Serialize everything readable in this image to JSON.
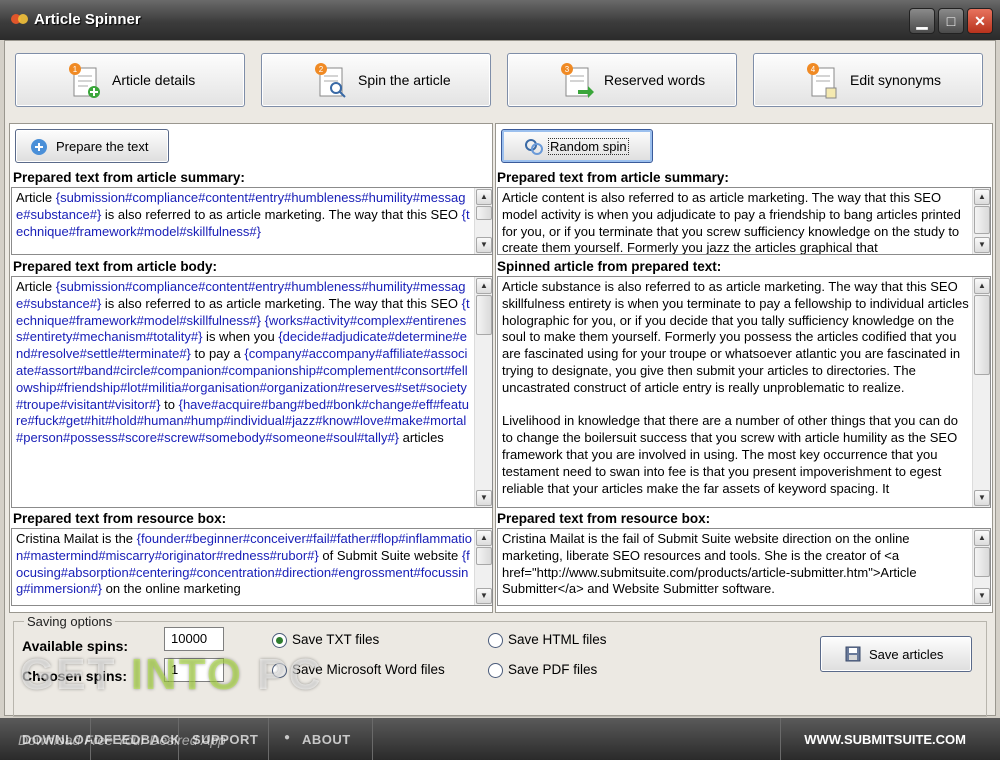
{
  "window": {
    "title": "Article Spinner",
    "controls": {
      "minimize": "▁",
      "maximize": "□",
      "close": "✕"
    }
  },
  "tabs": [
    {
      "label": "Article details",
      "step": "1"
    },
    {
      "label": "Spin the article",
      "step": "2"
    },
    {
      "label": "Reserved words",
      "step": "3"
    },
    {
      "label": "Edit synonyms",
      "step": "4"
    }
  ],
  "left": {
    "prepare_button": "Prepare the text",
    "summary": {
      "label": "Prepared text from article summary:",
      "segments": [
        {
          "t": "Article ",
          "h": false
        },
        {
          "t": "{submission#compliance#content#entry#humbleness#humility#message#substance#}",
          "h": true
        },
        {
          "t": " is also referred to as article marketing. The way that this SEO ",
          "h": false
        },
        {
          "t": "{technique#framework#model#skillfulness#}",
          "h": true
        }
      ]
    },
    "body": {
      "label": "Prepared text from article body:",
      "segments": [
        {
          "t": "Article ",
          "h": false
        },
        {
          "t": "{submission#compliance#content#entry#humbleness#humility#message#substance#}",
          "h": true
        },
        {
          "t": " is also referred to as article marketing. The way that this SEO ",
          "h": false
        },
        {
          "t": "{technique#framework#model#skillfulness#}",
          "h": true
        },
        {
          "t": " ",
          "h": false
        },
        {
          "t": "{works#activity#complex#entireness#entirety#mechanism#totality#}",
          "h": true
        },
        {
          "t": " is when you ",
          "h": false
        },
        {
          "t": "{decide#adjudicate#determine#end#resolve#settle#terminate#}",
          "h": true
        },
        {
          "t": " to pay a ",
          "h": false
        },
        {
          "t": "{company#accompany#affiliate#associate#assort#band#circle#companion#companionship#complement#consort#fellowship#friendship#lot#militia#organisation#organization#reserves#set#society#troupe#visitant#visitor#}",
          "h": true
        },
        {
          "t": " to ",
          "h": false
        },
        {
          "t": "{have#acquire#bang#bed#bonk#change#eff#feature#fuck#get#hit#hold#human#hump#individual#jazz#know#love#make#mortal#person#possess#score#screw#somebody#someone#soul#tally#}",
          "h": true
        },
        {
          "t": " articles",
          "h": false
        }
      ]
    },
    "resource": {
      "label": "Prepared text from resource box:",
      "segments": [
        {
          "t": "Cristina Mailat is the ",
          "h": false
        },
        {
          "t": "{founder#beginner#conceiver#fail#father#flop#inflammation#mastermind#miscarry#originator#redness#rubor#}",
          "h": true
        },
        {
          "t": " of Submit Suite website ",
          "h": false
        },
        {
          "t": "{focusing#absorption#centering#concentration#direction#engrossment#focussing#immersion#}",
          "h": true
        },
        {
          "t": " on the online marketing",
          "h": false
        }
      ]
    }
  },
  "right": {
    "random_button": "Random spin",
    "summary": {
      "label": "Prepared text from article summary:",
      "text": "Article content is also referred to as article marketing. The way that this SEO model activity is when you adjudicate to pay a friendship to bang articles printed for you, or if you terminate that you screw sufficiency knowledge on the study to create them yourself. Formerly you jazz the articles graphical that"
    },
    "spinned": {
      "label": "Spinned article from prepared text:",
      "text": "Article substance is also referred to as article marketing. The way that this SEO skillfulness entirety is when you terminate to pay a fellowship to individual articles holographic for you, or if you decide that you tally sufficiency knowledge on the soul to make them yourself. Formerly you possess the articles codified that you are fascinated using for your troupe or whatsoever atlantic you are fascinated in trying to designate, you give then submit your articles to directories. The uncastrated construct of article entry is really unproblematic to realize.\n\nLivelihood in knowledge that there are a number of other things that you can do to change the boilersuit success that you screw with article humility as the SEO framework that you are involved in using. The most key occurrence that you testament need to swan into fee is that you present impoverishment to egest reliable that your articles make the far assets of keyword spacing. It"
    },
    "resource": {
      "label": "Prepared text from resource box:",
      "text": "Cristina Mailat is the fail of Submit Suite website direction on the online marketing, liberate SEO resources and tools. She is the creator of <a href=\"http://www.submitsuite.com/products/article-submitter.htm\">Article Submitter</a> and Website Submitter software."
    }
  },
  "saving": {
    "legend": "Saving options",
    "available_label": "Available spins:",
    "available_value": "10000",
    "chosen_label": "Choosen spins:",
    "chosen_value": "1",
    "options": {
      "txt": "Save TXT files",
      "word": "Save Microsoft Word files",
      "html": "Save HTML files",
      "pdf": "Save PDF files"
    },
    "selected": "txt",
    "save_button": "Save articles"
  },
  "footer": {
    "items": [
      "DOWNLOAD",
      "FEEDBACK",
      "SUPPORT",
      "ABOUT"
    ],
    "site": "WWW.SUBMITSUITE.COM"
  },
  "watermark": {
    "part1": "GET ",
    "part2": "INTO",
    "part3": " PC",
    "sub": "Download Free Your Desired App"
  },
  "colors": {
    "token": "#1a20b8",
    "accent_green": "#2f7d2f",
    "title_bar": "#3c3c3c"
  }
}
